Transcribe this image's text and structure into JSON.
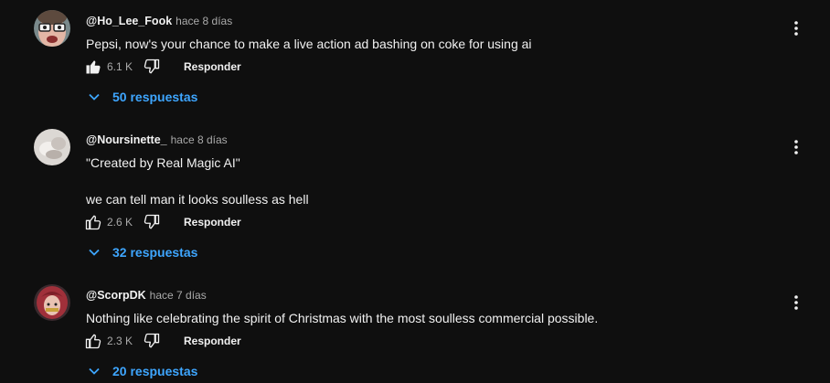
{
  "comments": [
    {
      "author": "@Ho_Lee_Fook",
      "time": "hace 8 días",
      "lines": [
        "Pepsi, now's your chance to make a live action ad bashing on coke for using ai"
      ],
      "likes": "6.1 K",
      "liked": true,
      "reply_label": "Responder",
      "replies_label": "50 respuestas",
      "avatar_icon": "avatar-cartoon-face"
    },
    {
      "author": "@Noursinette_",
      "time": "hace 8 días",
      "lines": [
        "\"Created by  Real Magic AI\"",
        "we can tell man it looks soulless as hell"
      ],
      "likes": "2.6 K",
      "liked": false,
      "reply_label": "Responder",
      "replies_label": "32 respuestas",
      "avatar_icon": "avatar-pale-photo"
    },
    {
      "author": "@ScorpDK",
      "time": "hace 7 días",
      "lines": [
        "Nothing like celebrating the spirit of Christmas with the most soulless commercial possible."
      ],
      "likes": "2.3 K",
      "liked": false,
      "reply_label": "Responder",
      "replies_label": "20 respuestas",
      "avatar_icon": "avatar-red-hair-character"
    }
  ],
  "colors": {
    "background": "#0f0f0f",
    "text": "#f1f1f1",
    "secondary_text": "#aaaaaa",
    "link_blue": "#3ea6ff"
  },
  "icons": [
    "thumb-up-icon",
    "thumb-down-icon",
    "chevron-down-icon",
    "more-vert-icon"
  ]
}
